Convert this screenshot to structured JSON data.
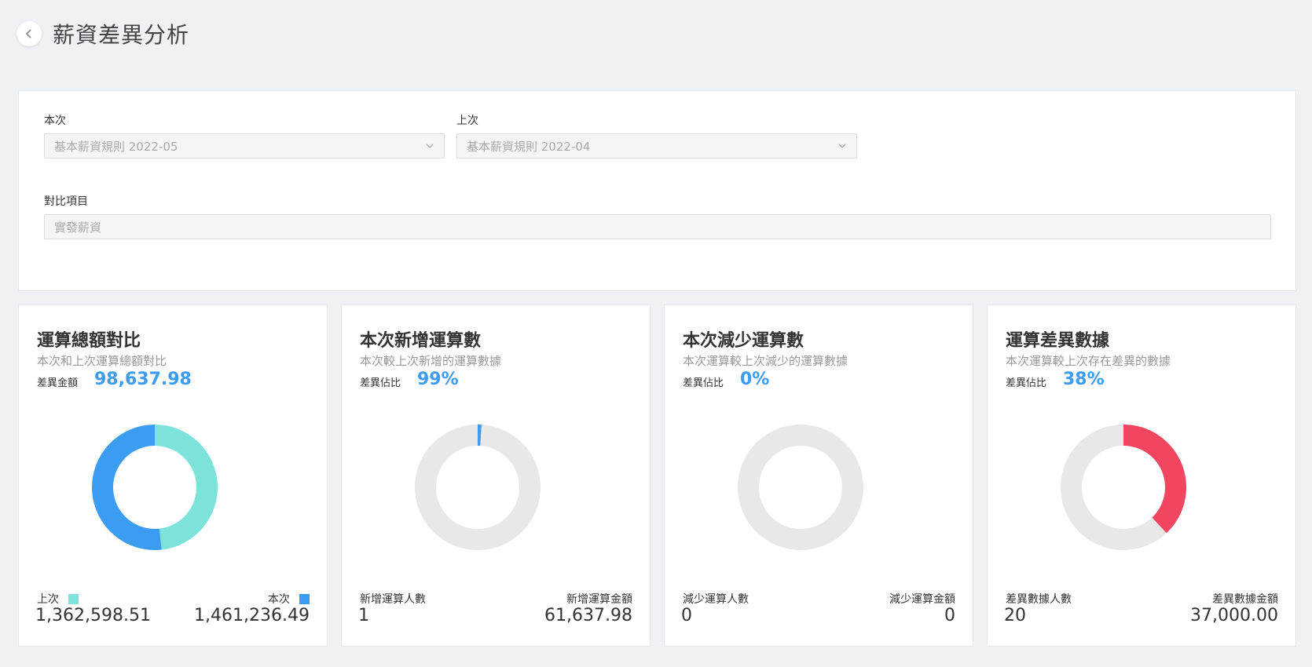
{
  "header": {
    "title": "薪資差異分析",
    "back_icon": "chevron-left-icon"
  },
  "filters": {
    "current_label": "本次",
    "current_value": "基本薪資規則 2022-05",
    "previous_label": "上次",
    "previous_value": "基本薪資規則 2022-04",
    "compare_label": "對比項目",
    "compare_value": "實發薪資"
  },
  "colors": {
    "accent": "#3b9cf2",
    "teal": "#7de3da",
    "blue": "#3b9cf2",
    "red": "#f2455f",
    "ring_gray": "#e8e8e8"
  },
  "cards": [
    {
      "title": "運算總額對比",
      "subtitle": "本次和上次運算總額對比",
      "metric_label": "差異金額",
      "metric_value": "98,637.98",
      "left_label": "上次",
      "left_value": "1,362,598.51",
      "right_label": "本次",
      "right_value": "1,461,236.49"
    },
    {
      "title": "本次新增運算數",
      "subtitle": "本次較上次新增的運算數據",
      "metric_label": "差異佔比",
      "metric_value": "99%",
      "left_label": "新增運算人數",
      "left_value": "1",
      "right_label": "新增運算金額",
      "right_value": "61,637.98"
    },
    {
      "title": "本次減少運算數",
      "subtitle": "本次運算較上次減少的運算數據",
      "metric_label": "差異佔比",
      "metric_value": "0%",
      "left_label": "減少運算人數",
      "left_value": "0",
      "right_label": "減少運算金額",
      "right_value": "0"
    },
    {
      "title": "運算差異數據",
      "subtitle": "本次運算較上次存在差異的數據",
      "metric_label": "差異佔比",
      "metric_value": "38%",
      "left_label": "差異數據人數",
      "left_value": "20",
      "right_label": "差異數據金額",
      "right_value": "37,000.00"
    }
  ],
  "chart_data": [
    {
      "type": "pie",
      "series": [
        {
          "name": "上次",
          "value": 1362598.51
        },
        {
          "name": "本次",
          "value": 1461236.49
        }
      ]
    },
    {
      "type": "pie",
      "series": [
        {
          "value": 1
        },
        {
          "value": 99
        }
      ]
    },
    {
      "type": "pie",
      "series": [
        {
          "value": 0
        },
        {
          "value": 100
        }
      ]
    },
    {
      "type": "pie",
      "series": [
        {
          "value": 38
        },
        {
          "value": 62
        }
      ]
    }
  ]
}
